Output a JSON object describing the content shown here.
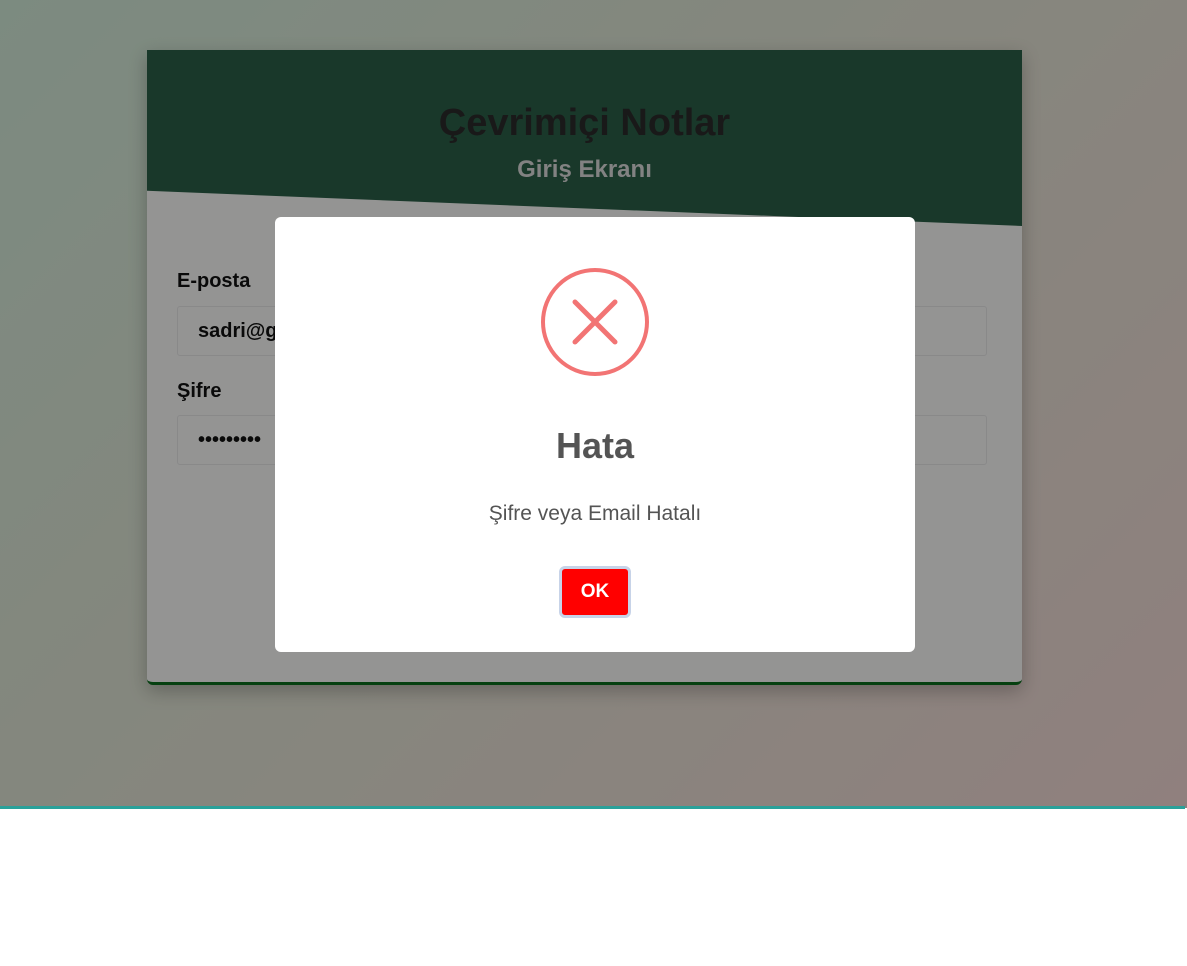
{
  "login": {
    "app_title": "Çevrimiçi Notlar",
    "screen_subtitle": "Giriş Ekranı",
    "email_label": "E-posta",
    "email_value": "sadri@g",
    "password_label": "Şifre",
    "password_value": "•••••••••"
  },
  "alert": {
    "icon": "error-x-icon",
    "title": "Hata",
    "message": "Şifre veya Email Hatalı",
    "ok_label": "OK"
  },
  "colors": {
    "header_bg": "#2a5e46",
    "card_border": "#0b6b1c",
    "error_icon": "#f27474",
    "ok_button": "#ff0000",
    "bottom_line": "#2aa19a"
  }
}
